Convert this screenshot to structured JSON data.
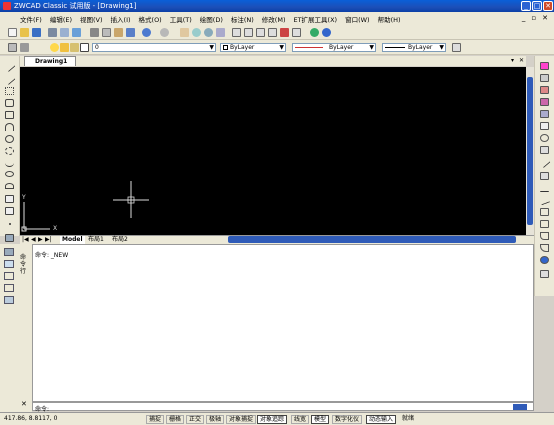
{
  "title": {
    "text": "ZWCAD Classic 试用版 - [Drawing1]",
    "min": "_",
    "max": "□",
    "close": "✕"
  },
  "menu": {
    "items": [
      "文件(F)",
      "编辑(E)",
      "视图(V)",
      "插入(I)",
      "格式(O)",
      "工具(T)",
      "绘图(D)",
      "标注(N)",
      "修改(M)",
      "ET扩展工具(X)",
      "窗口(W)",
      "帮助(H)"
    ],
    "win_min": "_",
    "win_max": "▫",
    "win_close": "✕"
  },
  "layers": {
    "current_layer": "0",
    "color": "ByLayer",
    "linetype": "ByLayer",
    "lineweight": "ByLayer"
  },
  "document": {
    "tab_label": "Drawing1",
    "ucs_x": "X",
    "ucs_y": "Y"
  },
  "layout_tabs": [
    "Model",
    "布局1",
    "布局2"
  ],
  "nav_arrows": [
    "|◀",
    "◀",
    "▶",
    "▶|"
  ],
  "command": {
    "prompt": "命令:",
    "history": "命令: _NEW",
    "side_label": "命令行",
    "close": "✕"
  },
  "status": {
    "coords": "417.86, 8.8117, 0",
    "toggles": [
      {
        "label": "捕捉",
        "on": false
      },
      {
        "label": "栅格",
        "on": false
      },
      {
        "label": "正交",
        "on": false
      },
      {
        "label": "极轴",
        "on": false
      },
      {
        "label": "对象捕捉",
        "on": false
      },
      {
        "label": "对象追踪",
        "on": true
      },
      {
        "label": "线宽",
        "on": false
      },
      {
        "label": "模型",
        "on": true
      },
      {
        "label": "数字化仪",
        "on": false
      },
      {
        "label": "动态输入",
        "on": true
      },
      {
        "label": "就绪",
        "on": false
      }
    ]
  },
  "colors": {
    "titlebar": "#0b4fc0",
    "canvas": "#000000",
    "scroll_thumb": "#2f5bb8",
    "chrome": "#ece9d8"
  }
}
